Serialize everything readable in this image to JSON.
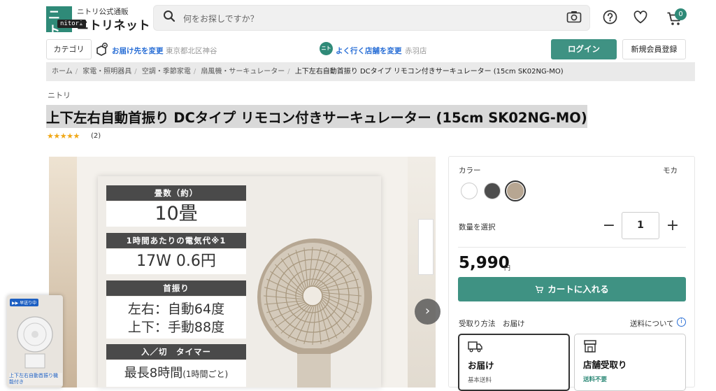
{
  "header": {
    "logo_mark": "ニト リ",
    "logo_tooltip": "nitori",
    "logo_sub": "ニトリ公式通販",
    "logo_main": "ニトリネット",
    "search_placeholder": "何をお探しですか？",
    "cart_count": "0"
  },
  "subheader": {
    "category_label": "カテゴリ",
    "delivery_label": "お届け先を変更",
    "delivery_address": "東京都北区神谷",
    "store_icon_text": "ニトリ",
    "store_label": "よく行く店舗を変更",
    "store_name": "赤羽店",
    "login_label": "ログイン",
    "signup_label": "新規会員登録"
  },
  "breadcrumb": [
    "ホーム",
    "家電・照明器具",
    "空調・季節家電",
    "扇風機・サーキュレーター",
    "上下左右自動首振り DCタイプ リモコン付きサーキュレーター (15cm SK02NG-MO)"
  ],
  "product": {
    "brand": "ニトリ",
    "title": "上下左右自動首振り DCタイプ リモコン付きサーキュレーター (15cm SK02NG-MO)",
    "stars": "★★★★★",
    "rating_fraction": 1.0,
    "rating_count": "(2)"
  },
  "gallery": {
    "specs": [
      {
        "head": "畳数（約）",
        "value": "10畳"
      },
      {
        "head": "1時間あたりの電気代※1",
        "value": "17W  0.6円"
      },
      {
        "head": "首振り",
        "value": "左右：自動64度",
        "value2": "上下：手動88度"
      },
      {
        "head": "入／切　タイマー",
        "value": "最長8時間",
        "value_small": "(1時間ごと)"
      }
    ],
    "next_arrow": "›",
    "float_tag": "▶▶ 早送り中",
    "float_caption": "上下左右自動首振り機能付き"
  },
  "purchase": {
    "color_label": "カラー",
    "color_value": "モカ",
    "swatches": [
      {
        "name": "white",
        "color": "#ffffff"
      },
      {
        "name": "dark-gray",
        "color": "#4d4d4d"
      },
      {
        "name": "mocha",
        "color": "#b7a692"
      }
    ],
    "qty_label": "数量を選択",
    "qty_minus": "−",
    "qty_value": "1",
    "qty_plus": "+",
    "price": "5,990",
    "price_unit": "円",
    "cart_button": "カートに入れる",
    "pickup_label": "受取り方法",
    "pickup_value": "お届け",
    "shipping_about": "送料について",
    "options": [
      {
        "title": "お届け",
        "sub": "基本送料"
      },
      {
        "title": "店舗受取り",
        "sub": "送料不要"
      }
    ]
  },
  "colors": {
    "brand_green": "#3f9283",
    "link_blue": "#2a6fd6",
    "star": "#f0a818"
  }
}
